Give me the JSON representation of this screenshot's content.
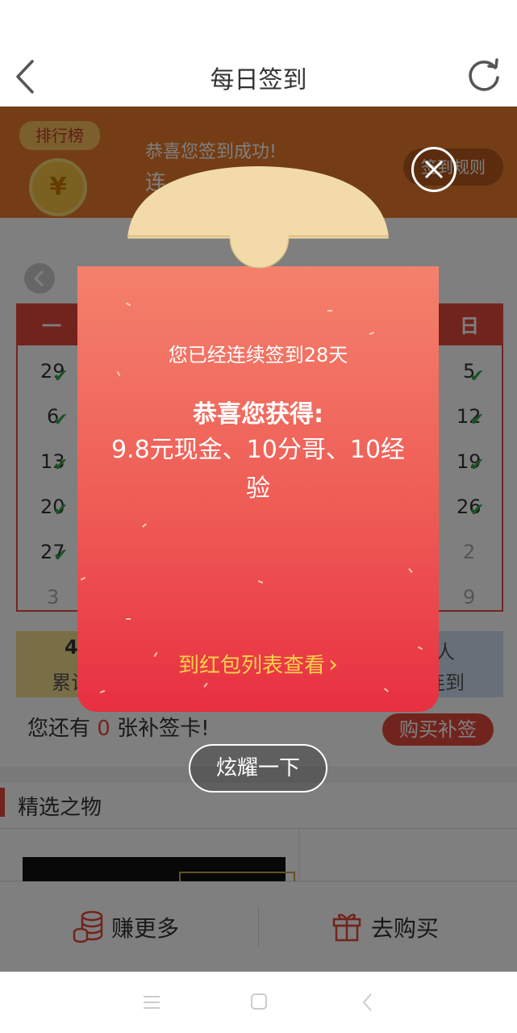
{
  "header": {
    "title": "每日签到"
  },
  "banner": {
    "rank_label": "排行榜",
    "coin_symbol": "¥",
    "success_msg": "恭喜您签到成功!",
    "streak_partial": "连",
    "rules_label": "签到规则"
  },
  "calendar": {
    "weekday_first": "一",
    "weekday_last": "日",
    "left_column": [
      "29",
      "6",
      "13",
      "20",
      "27",
      "3"
    ],
    "right_column": [
      "5",
      "12",
      "19",
      "26",
      "2",
      "9"
    ],
    "checked_rows": 5
  },
  "stats": {
    "left_value": "4",
    "left_label": "累计",
    "right_value": "人",
    "right_label": "连到"
  },
  "makeup": {
    "prefix": "您还有",
    "count": "0",
    "suffix": "张补签卡!",
    "buy_label": "购买补签"
  },
  "featured": {
    "title": "精选之物"
  },
  "bottom_bar": {
    "earn_label": "赚更多",
    "buy_label": "去购买"
  },
  "popup": {
    "streak_msg": "您已经连续签到28天",
    "congrats": "恭喜您获得:",
    "reward": "9.8元现金、10分哥、10经验",
    "link_label": "到红包列表查看",
    "link_arrow": "›",
    "show_off_label": "炫耀一下"
  },
  "colors": {
    "accent_red": "#e2493b",
    "packet_top": "#f4816c",
    "packet_bottom": "#e82f41",
    "flap": "#f2dba9",
    "link_yellow": "#ffd24a"
  },
  "icons": [
    "back-icon",
    "refresh-icon",
    "close-icon",
    "coins-icon",
    "gift-icon",
    "check-icon",
    "chevron-left-icon"
  ]
}
